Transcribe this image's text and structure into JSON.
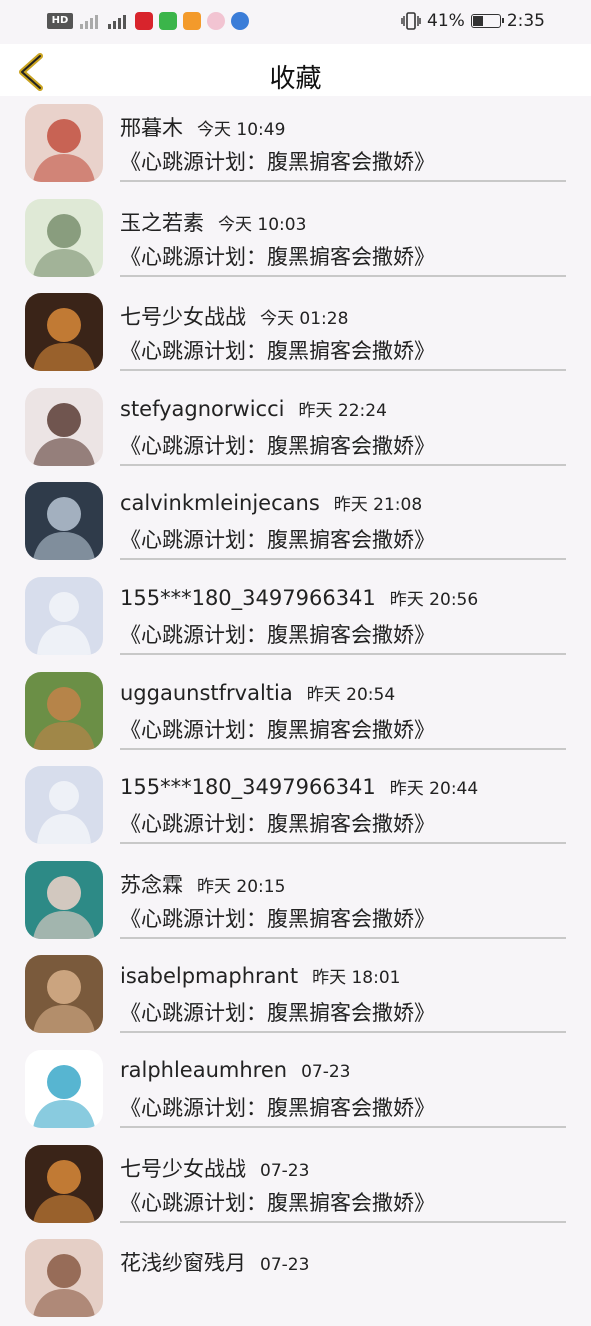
{
  "status_bar": {
    "network_badge": "HD",
    "battery_percent": "41%",
    "battery_level": 0.41,
    "time": "2:35"
  },
  "header": {
    "title": "收藏"
  },
  "items": [
    {
      "name": "邢暮木",
      "time": "今天 10:49",
      "work": "《心跳源计划：腹黑掮客会撒娇》",
      "avatar": {
        "bg": "#e9d2cb",
        "fg": "#c2503f",
        "kind": "photo"
      }
    },
    {
      "name": "玉之若素",
      "time": "今天 10:03",
      "work": "《心跳源计划：腹黑掮客会撒娇》",
      "avatar": {
        "bg": "#dfe9d6",
        "fg": "#7a8f6e",
        "kind": "photo"
      }
    },
    {
      "name": "七号少女战战",
      "time": "今天 01:28",
      "work": "《心跳源计划：腹黑掮客会撒娇》",
      "avatar": {
        "bg": "#3a2418",
        "fg": "#d98a3a",
        "kind": "photo"
      }
    },
    {
      "name": "stefyagnorwicci",
      "time": "昨天 22:24",
      "work": "《心跳源计划：腹黑掮客会撒娇》",
      "avatar": {
        "bg": "#ece4e4",
        "fg": "#5b3c35",
        "kind": "photo"
      }
    },
    {
      "name": "calvinkmleinjecans",
      "time": "昨天 21:08",
      "work": "《心跳源计划：腹黑掮客会撒娇》",
      "avatar": {
        "bg": "#2f3b4a",
        "fg": "#b7c6d3",
        "kind": "photo"
      }
    },
    {
      "name": "155***180_3497966341",
      "time": "昨天 20:56",
      "work": "《心跳源计划：腹黑掮客会撒娇》",
      "avatar": {
        "bg": "#d7ddec",
        "fg": "#eef1f7",
        "kind": "default"
      }
    },
    {
      "name": "uggaunstfrvaltia",
      "time": "昨天 20:54",
      "work": "《心跳源计划：腹黑掮客会撒娇》",
      "avatar": {
        "bg": "#6b8f46",
        "fg": "#c3824a",
        "kind": "photo"
      }
    },
    {
      "name": "155***180_3497966341",
      "time": "昨天 20:44",
      "work": "《心跳源计划：腹黑掮客会撒娇》",
      "avatar": {
        "bg": "#d7ddec",
        "fg": "#eef1f7",
        "kind": "default"
      }
    },
    {
      "name": "苏念霖",
      "time": "昨天 20:15",
      "work": "《心跳源计划：腹黑掮客会撒娇》",
      "avatar": {
        "bg": "#2d8a86",
        "fg": "#f0d2c9",
        "kind": "photo"
      }
    },
    {
      "name": "isabelpmaphrant",
      "time": "昨天 18:01",
      "work": "《心跳源计划：腹黑掮客会撒娇》",
      "avatar": {
        "bg": "#7a5a3c",
        "fg": "#d9b18b",
        "kind": "photo"
      }
    },
    {
      "name": "ralphleaumhren",
      "time": "07-23",
      "work": "《心跳源计划：腹黑掮客会撒娇》",
      "avatar": {
        "bg": "#ffffff",
        "fg": "#3aa8c9",
        "kind": "photo"
      }
    },
    {
      "name": "七号少女战战",
      "time": "07-23",
      "work": "《心跳源计划：腹黑掮客会撒娇》",
      "avatar": {
        "bg": "#3a2418",
        "fg": "#d98a3a",
        "kind": "photo"
      }
    },
    {
      "name": "花浅纱窗残月",
      "time": "07-23",
      "work": "",
      "avatar": {
        "bg": "#e5cfc6",
        "fg": "#8a5a44",
        "kind": "photo"
      }
    }
  ]
}
